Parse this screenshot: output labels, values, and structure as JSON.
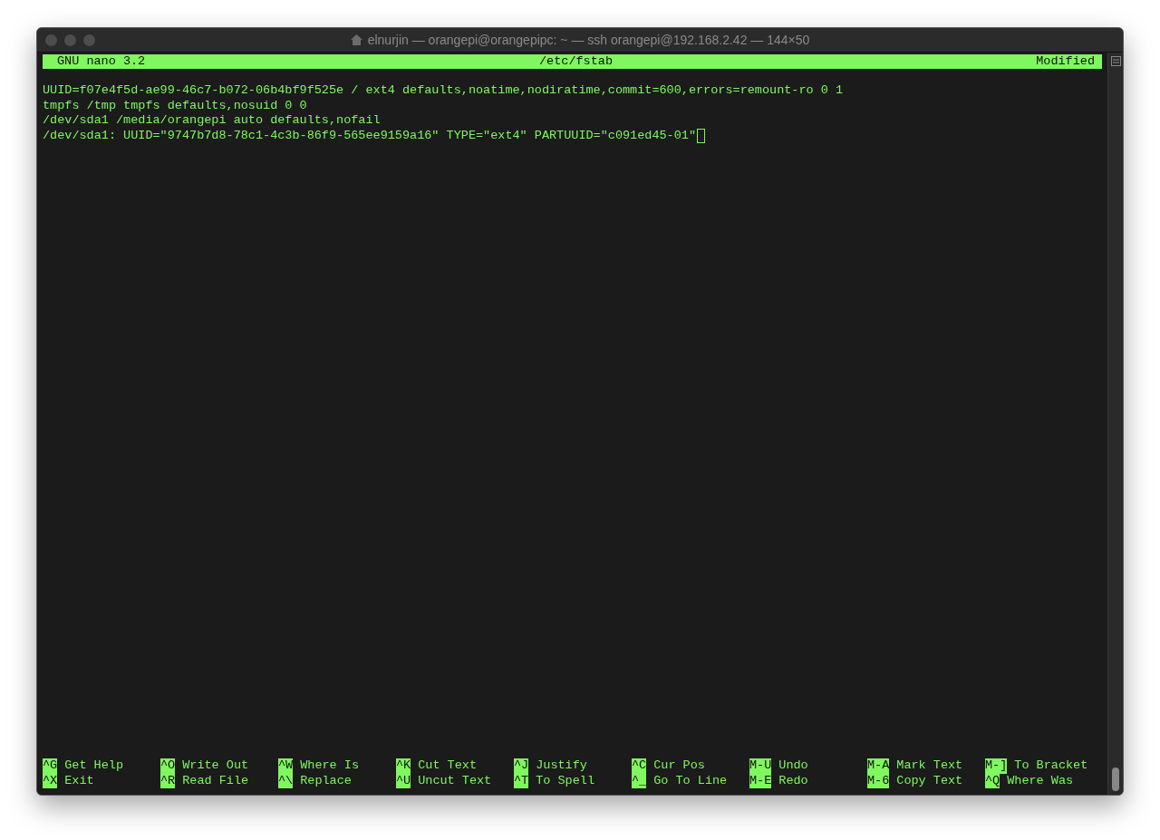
{
  "window": {
    "title": "elnurjin — orangepi@orangepipc: ~ — ssh orangepi@192.168.2.42 — 144×50"
  },
  "header": {
    "app": "GNU nano 3.2",
    "file": "/etc/fstab",
    "status": "Modified"
  },
  "lines": [
    "UUID=f07e4f5d-ae99-46c7-b072-06b4bf9f525e / ext4 defaults,noatime,nodiratime,commit=600,errors=remount-ro 0 1",
    "tmpfs /tmp tmpfs defaults,nosuid 0 0",
    "/dev/sda1 /media/orangepi auto defaults,nofail",
    "/dev/sda1: UUID=\"9747b7d8-78c1-4c3b-86f9-565ee9159a16\" TYPE=\"ext4\" PARTUUID=\"c091ed45-01\""
  ],
  "shortcut_rows": [
    [
      {
        "key": "^G",
        "label": "Get Help"
      },
      {
        "key": "^O",
        "label": "Write Out"
      },
      {
        "key": "^W",
        "label": "Where Is"
      },
      {
        "key": "^K",
        "label": "Cut Text"
      },
      {
        "key": "^J",
        "label": "Justify"
      },
      {
        "key": "^C",
        "label": "Cur Pos"
      },
      {
        "key": "M-U",
        "label": "Undo"
      },
      {
        "key": "M-A",
        "label": "Mark Text"
      },
      {
        "key": "M-]",
        "label": "To Bracket"
      }
    ],
    [
      {
        "key": "^X",
        "label": "Exit"
      },
      {
        "key": "^R",
        "label": "Read File"
      },
      {
        "key": "^\\",
        "label": "Replace"
      },
      {
        "key": "^U",
        "label": "Uncut Text"
      },
      {
        "key": "^T",
        "label": "To Spell"
      },
      {
        "key": "^_",
        "label": "Go To Line"
      },
      {
        "key": "M-E",
        "label": "Redo"
      },
      {
        "key": "M-6",
        "label": "Copy Text"
      },
      {
        "key": "^Q",
        "label": "Where Was"
      }
    ]
  ]
}
